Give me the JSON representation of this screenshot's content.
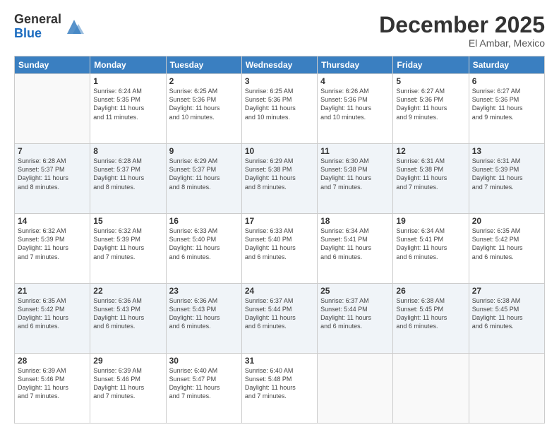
{
  "logo": {
    "general": "General",
    "blue": "Blue"
  },
  "title": "December 2025",
  "location": "El Ambar, Mexico",
  "weekdays": [
    "Sunday",
    "Monday",
    "Tuesday",
    "Wednesday",
    "Thursday",
    "Friday",
    "Saturday"
  ],
  "weeks": [
    [
      {
        "day": "",
        "info": ""
      },
      {
        "day": "1",
        "info": "Sunrise: 6:24 AM\nSunset: 5:35 PM\nDaylight: 11 hours\nand 11 minutes."
      },
      {
        "day": "2",
        "info": "Sunrise: 6:25 AM\nSunset: 5:36 PM\nDaylight: 11 hours\nand 10 minutes."
      },
      {
        "day": "3",
        "info": "Sunrise: 6:25 AM\nSunset: 5:36 PM\nDaylight: 11 hours\nand 10 minutes."
      },
      {
        "day": "4",
        "info": "Sunrise: 6:26 AM\nSunset: 5:36 PM\nDaylight: 11 hours\nand 10 minutes."
      },
      {
        "day": "5",
        "info": "Sunrise: 6:27 AM\nSunset: 5:36 PM\nDaylight: 11 hours\nand 9 minutes."
      },
      {
        "day": "6",
        "info": "Sunrise: 6:27 AM\nSunset: 5:36 PM\nDaylight: 11 hours\nand 9 minutes."
      }
    ],
    [
      {
        "day": "7",
        "info": "Sunrise: 6:28 AM\nSunset: 5:37 PM\nDaylight: 11 hours\nand 8 minutes."
      },
      {
        "day": "8",
        "info": "Sunrise: 6:28 AM\nSunset: 5:37 PM\nDaylight: 11 hours\nand 8 minutes."
      },
      {
        "day": "9",
        "info": "Sunrise: 6:29 AM\nSunset: 5:37 PM\nDaylight: 11 hours\nand 8 minutes."
      },
      {
        "day": "10",
        "info": "Sunrise: 6:29 AM\nSunset: 5:38 PM\nDaylight: 11 hours\nand 8 minutes."
      },
      {
        "day": "11",
        "info": "Sunrise: 6:30 AM\nSunset: 5:38 PM\nDaylight: 11 hours\nand 7 minutes."
      },
      {
        "day": "12",
        "info": "Sunrise: 6:31 AM\nSunset: 5:38 PM\nDaylight: 11 hours\nand 7 minutes."
      },
      {
        "day": "13",
        "info": "Sunrise: 6:31 AM\nSunset: 5:39 PM\nDaylight: 11 hours\nand 7 minutes."
      }
    ],
    [
      {
        "day": "14",
        "info": "Sunrise: 6:32 AM\nSunset: 5:39 PM\nDaylight: 11 hours\nand 7 minutes."
      },
      {
        "day": "15",
        "info": "Sunrise: 6:32 AM\nSunset: 5:39 PM\nDaylight: 11 hours\nand 7 minutes."
      },
      {
        "day": "16",
        "info": "Sunrise: 6:33 AM\nSunset: 5:40 PM\nDaylight: 11 hours\nand 6 minutes."
      },
      {
        "day": "17",
        "info": "Sunrise: 6:33 AM\nSunset: 5:40 PM\nDaylight: 11 hours\nand 6 minutes."
      },
      {
        "day": "18",
        "info": "Sunrise: 6:34 AM\nSunset: 5:41 PM\nDaylight: 11 hours\nand 6 minutes."
      },
      {
        "day": "19",
        "info": "Sunrise: 6:34 AM\nSunset: 5:41 PM\nDaylight: 11 hours\nand 6 minutes."
      },
      {
        "day": "20",
        "info": "Sunrise: 6:35 AM\nSunset: 5:42 PM\nDaylight: 11 hours\nand 6 minutes."
      }
    ],
    [
      {
        "day": "21",
        "info": "Sunrise: 6:35 AM\nSunset: 5:42 PM\nDaylight: 11 hours\nand 6 minutes."
      },
      {
        "day": "22",
        "info": "Sunrise: 6:36 AM\nSunset: 5:43 PM\nDaylight: 11 hours\nand 6 minutes."
      },
      {
        "day": "23",
        "info": "Sunrise: 6:36 AM\nSunset: 5:43 PM\nDaylight: 11 hours\nand 6 minutes."
      },
      {
        "day": "24",
        "info": "Sunrise: 6:37 AM\nSunset: 5:44 PM\nDaylight: 11 hours\nand 6 minutes."
      },
      {
        "day": "25",
        "info": "Sunrise: 6:37 AM\nSunset: 5:44 PM\nDaylight: 11 hours\nand 6 minutes."
      },
      {
        "day": "26",
        "info": "Sunrise: 6:38 AM\nSunset: 5:45 PM\nDaylight: 11 hours\nand 6 minutes."
      },
      {
        "day": "27",
        "info": "Sunrise: 6:38 AM\nSunset: 5:45 PM\nDaylight: 11 hours\nand 6 minutes."
      }
    ],
    [
      {
        "day": "28",
        "info": "Sunrise: 6:39 AM\nSunset: 5:46 PM\nDaylight: 11 hours\nand 7 minutes."
      },
      {
        "day": "29",
        "info": "Sunrise: 6:39 AM\nSunset: 5:46 PM\nDaylight: 11 hours\nand 7 minutes."
      },
      {
        "day": "30",
        "info": "Sunrise: 6:40 AM\nSunset: 5:47 PM\nDaylight: 11 hours\nand 7 minutes."
      },
      {
        "day": "31",
        "info": "Sunrise: 6:40 AM\nSunset: 5:48 PM\nDaylight: 11 hours\nand 7 minutes."
      },
      {
        "day": "",
        "info": ""
      },
      {
        "day": "",
        "info": ""
      },
      {
        "day": "",
        "info": ""
      }
    ]
  ]
}
